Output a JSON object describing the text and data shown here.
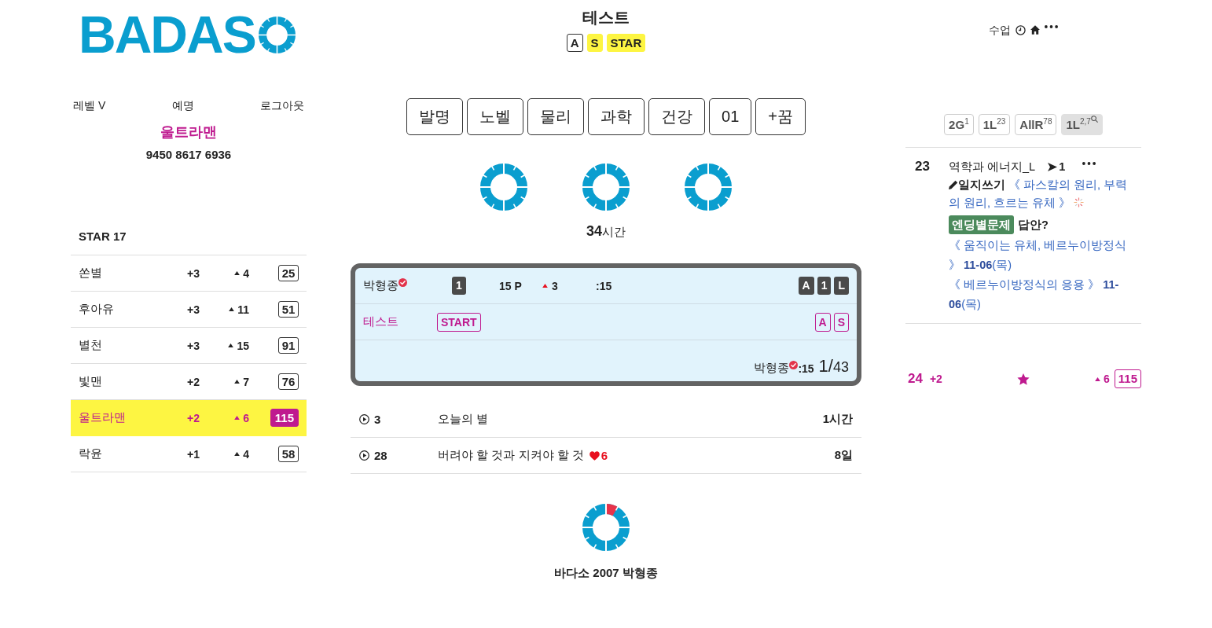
{
  "header": {
    "logo_text": "BADAS",
    "title": "테스트",
    "title_badges": [
      {
        "label": "A",
        "kind": "outline"
      },
      {
        "label": "S",
        "kind": "highlight"
      },
      {
        "label": "STAR",
        "kind": "highlight"
      }
    ],
    "menu_label": "수업"
  },
  "profile": {
    "links": [
      "레벨 V",
      "예명",
      "로그아웃"
    ],
    "nickname": "울트라맨",
    "code": "9450 8617 6936"
  },
  "ranking": {
    "title": "STAR 17",
    "rows": [
      {
        "name": "쏜별",
        "plus": "+3",
        "rise": "4",
        "score": "25",
        "selected": false
      },
      {
        "name": "후아유",
        "plus": "+3",
        "rise": "11",
        "score": "51",
        "selected": false
      },
      {
        "name": "별천",
        "plus": "+3",
        "rise": "15",
        "score": "91",
        "selected": false
      },
      {
        "name": "빛맨",
        "plus": "+2",
        "rise": "7",
        "score": "76",
        "selected": false
      },
      {
        "name": "울트라맨",
        "plus": "+2",
        "rise": "6",
        "score": "115",
        "selected": true
      },
      {
        "name": "락윤",
        "plus": "+1",
        "rise": "4",
        "score": "58",
        "selected": false
      }
    ]
  },
  "categories": [
    "발명",
    "노벨",
    "물리",
    "과학",
    "건강",
    "01",
    "+꿈"
  ],
  "total_time": "**34**시간",
  "match_card": {
    "player": "박형종",
    "rank": "1",
    "points": "15 P",
    "rise": "3",
    "time": ":15",
    "player_badges": [
      "A",
      "1",
      "L"
    ],
    "test_name": "테스트",
    "status": "START",
    "test_badges": [
      "A",
      "S"
    ],
    "footer_player": "박형종",
    "footer_time": ":15",
    "footer_score": "1/43"
  },
  "videos": [
    {
      "count": "3",
      "title": "오늘의 별",
      "duration": "1시간"
    },
    {
      "count": "28",
      "title": "버려야 할 것과 지켜야 할 것",
      "likes": "6",
      "duration": "8일"
    }
  ],
  "footer": {
    "text": "바다소 2007 박형종"
  },
  "tabs": [
    {
      "label": "2G$^{1}$",
      "selected": false
    },
    {
      "label": "1L$^{23}$",
      "selected": false
    },
    {
      "label": "AllR$^{78}$",
      "selected": false
    },
    {
      "label": "1L$^{2,7}$",
      "selected": true
    }
  ],
  "lesson": {
    "number": "23",
    "title": "역학과 에너지_L",
    "count": "1",
    "journal_label": "일지쓰기",
    "journal_topics": "《 파스칼의 원리, 부력의 원리, 흐르는 유체 》",
    "quiz_label": "엔딩별문제",
    "quiz_prompt": "답안?",
    "links": [
      "《 움직이는 유체, 베르누이방정식 》 **11-06**(목)",
      "《 베르누이방정식의 응용 》 **11-06**(목)"
    ]
  },
  "my_rank": {
    "rank": "24",
    "plus": "+2",
    "rise": "6",
    "score": "115"
  }
}
